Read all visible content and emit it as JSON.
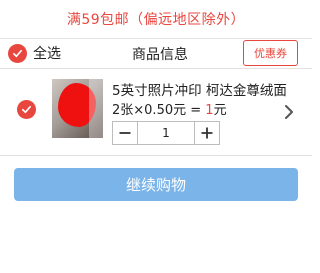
{
  "promo": {
    "text": "满59包邮（偏远地区除外）"
  },
  "header": {
    "select_all_label": "全选",
    "column_title": "商品信息",
    "coupon_label": "优惠券"
  },
  "item": {
    "title": "5英寸照片冲印 柯达金尊绒面",
    "price_prefix": "2张×0.50元 = ",
    "price_total": "1",
    "price_suffix": "元",
    "quantity": "1",
    "selected": true
  },
  "actions": {
    "continue_label": "继续购物"
  },
  "colors": {
    "accent": "#e8473f",
    "button": "#7ab4e8",
    "divider": "#e2e2e2"
  },
  "icons": [
    "check-icon",
    "minus-icon",
    "plus-icon",
    "chevron-right-icon"
  ]
}
